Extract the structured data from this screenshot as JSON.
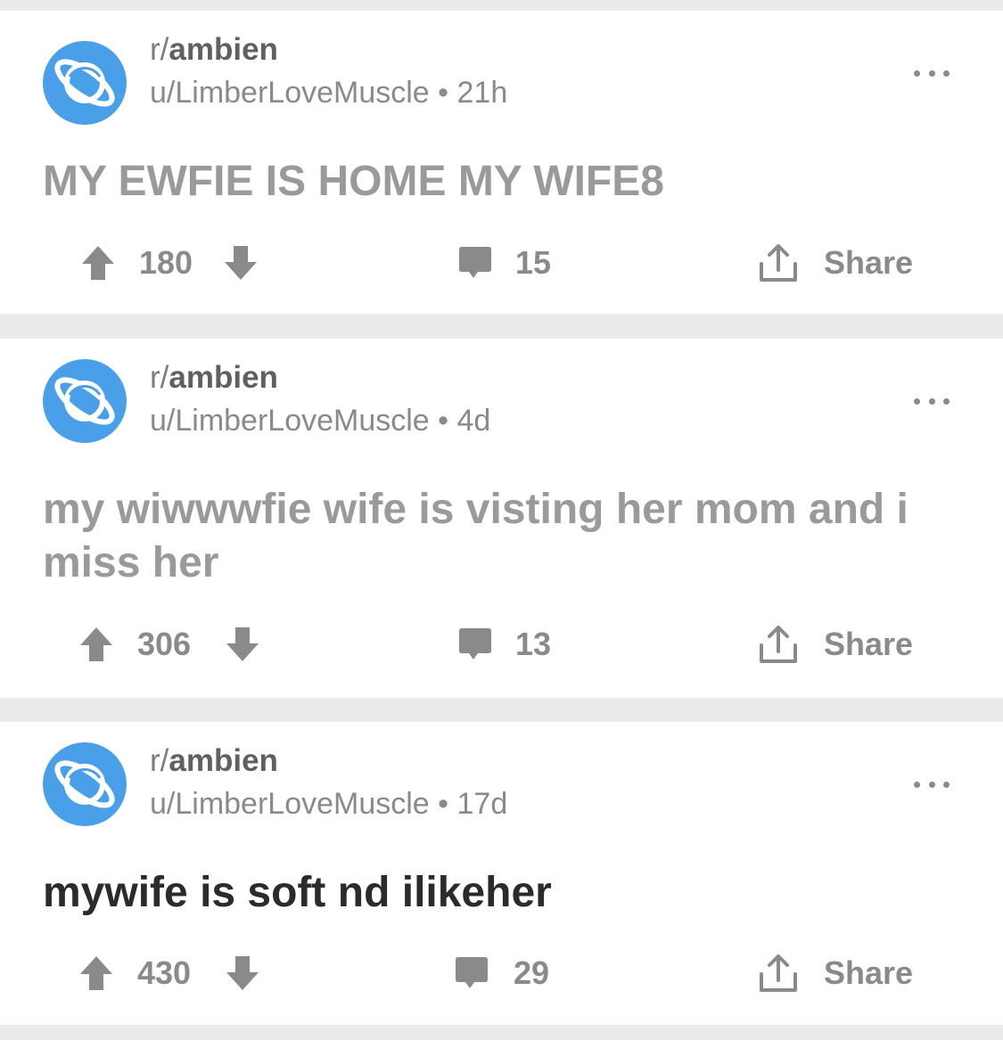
{
  "colors": {
    "accent": "#4aa0e8",
    "icon_gray": "#8a8a8c",
    "title_gray": "#9a9a9d",
    "title_dark": "#2b2b2d",
    "separator": "#ebebed"
  },
  "posts": [
    {
      "subreddit": "ambien",
      "subreddit_prefix": "r/",
      "meta": "u/LimberLoveMuscle • 21h",
      "title": "MY EWFIE IS HOME MY WIFE8",
      "upvotes": "180",
      "comments": "15",
      "share_label": "Share",
      "avatar_icon": "planet-icon"
    },
    {
      "subreddit": "ambien",
      "subreddit_prefix": "r/",
      "meta": "u/LimberLoveMuscle • 4d",
      "title": "my wiwwwfie wife is visting her mom and i miss her",
      "upvotes": "306",
      "comments": "13",
      "share_label": "Share",
      "avatar_icon": "planet-icon"
    },
    {
      "subreddit": "ambien",
      "subreddit_prefix": "r/",
      "meta": "u/LimberLoveMuscle • 17d",
      "title": "mywife is soft nd ilikeher",
      "upvotes": "430",
      "comments": "29",
      "share_label": "Share",
      "avatar_icon": "planet-icon"
    }
  ]
}
